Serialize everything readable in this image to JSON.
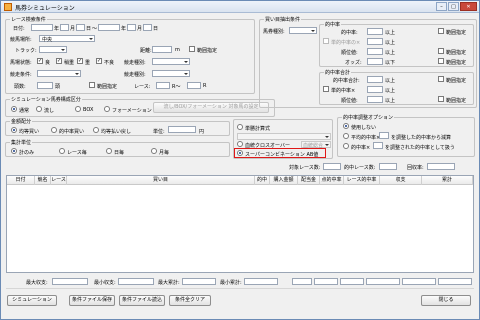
{
  "window": {
    "title": "馬券シミュレーション",
    "min": "–",
    "max": "□",
    "close": "✕"
  },
  "race": {
    "legend": "レース検索条件",
    "date_label": "日付:",
    "year": "年",
    "month": "月",
    "day": "日",
    "tilde": "～",
    "year2": "年",
    "month2": "月",
    "day2": "日",
    "venue_label": "競馬場所:",
    "venue_value": "中央",
    "track_label": "トラック:",
    "distance_label": "距離:",
    "distance_unit": "m",
    "range_label": "範囲指定",
    "baba_label": "馬場状態:",
    "baba": [
      "良",
      "稍重",
      "重",
      "不良"
    ],
    "class_label": "競走種別:",
    "cond_label": "競走条件:",
    "weight_label": "競走種別:",
    "horses_label": "頭数:",
    "horses_value": "頭",
    "range2_label": "範囲指定",
    "race_label": "レース:",
    "race_from": "R～",
    "race_to": "R"
  },
  "sim": {
    "legend": "シミュレーション馬券構成区分",
    "types": [
      "通常",
      "流し",
      "BOX",
      "フォーメーション"
    ],
    "nagashi_btn": "流し/BOX/フォーメーション 対象馬の設定"
  },
  "amount": {
    "legend": "金額配分",
    "options": [
      "均等買い",
      "的中率買い",
      "均等払い戻し"
    ],
    "unit_label": "単位:",
    "unit_suffix": "円"
  },
  "totals": {
    "legend": "集計単位",
    "options": [
      "計のみ",
      "レース毎",
      "日毎",
      "月毎"
    ]
  },
  "bets": {
    "legend": "買い目抽出条件",
    "type_label": "馬券種別:",
    "hit_legend": "的中率",
    "hit_label": "的中率:",
    "ijou": "以上",
    "range": "範囲指定",
    "sub_label": "単的中率の×",
    "sub_ijou": "以上",
    "rank_label": "順位値:",
    "rank_ijou": "以上",
    "odds_label": "オッズ:",
    "odds_ika": "以下",
    "sum_legend": "的中率合計",
    "sum_label": "的中率合計:",
    "sum_ijou": "以上",
    "sub2_label": "単的中率×",
    "sub2_ijou": "以上",
    "rank2_label": "順位値:",
    "rank2_ijou": "以上"
  },
  "calc": {
    "reg_label": "単勝計算式",
    "cross_label": "血統クロスオーバー",
    "cross_value": "血統総合",
    "super_label": "スーパーコンビネーション AB値"
  },
  "adjust": {
    "legend": "的中率調整オプション",
    "none": "使用しない",
    "opt1": "平均的中率×",
    "opt1b": "を調整した的中率から減算",
    "opt2": "的中率×",
    "opt2b": "を調整された的中率として扱う"
  },
  "counts": {
    "race_count_label": "対象レース数:",
    "hit_count_label": "的中レース数:",
    "rate_label": "回収率:"
  },
  "grid": {
    "headers": [
      "日付",
      "競名",
      "レース",
      "買い目",
      "的中",
      "購入金額",
      "配当金",
      "点的中率",
      "レース的中率",
      "収支",
      "累計"
    ]
  },
  "summary": {
    "max_income": "最大収支:",
    "min_income": "最小収支:",
    "max_cum": "最大累計:",
    "min_cum": "最小累計:"
  },
  "buttons": {
    "sim": "シミュレーション",
    "save": "条件ファイル保存",
    "load": "条件ファイル読込",
    "clear": "条件全クリア",
    "close": "閉じる"
  }
}
